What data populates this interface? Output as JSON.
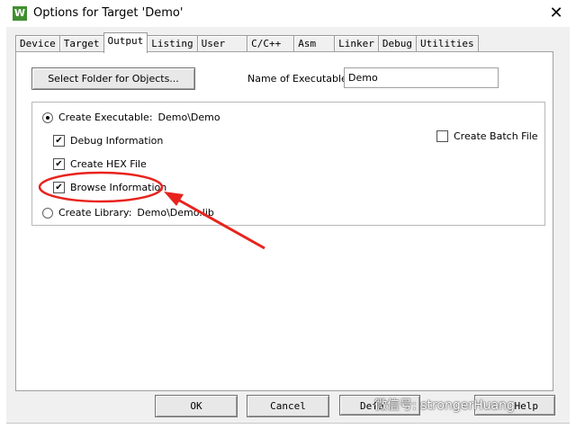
{
  "window": {
    "title": "Options for Target 'Demo'",
    "app_icon_glyph": "W",
    "close_glyph": "✕"
  },
  "tabs": [
    {
      "label": "Device"
    },
    {
      "label": "Target"
    },
    {
      "label": "Output",
      "active": true
    },
    {
      "label": "Listing"
    },
    {
      "label": "User"
    },
    {
      "label": "C/C++"
    },
    {
      "label": "Asm"
    },
    {
      "label": "Linker"
    },
    {
      "label": "Debug"
    },
    {
      "label": "Utilities"
    }
  ],
  "output": {
    "select_folder_label": "Select Folder for Objects...",
    "name_label": "Name of Executable:",
    "name_value": "Demo",
    "create_executable": {
      "label": "Create Executable:",
      "value": "Demo\\Demo",
      "selected": true
    },
    "debug_info": {
      "label": "Debug Information",
      "checked": true
    },
    "create_hex": {
      "label": "Create HEX File",
      "checked": true
    },
    "browse_info": {
      "label": "Browse Information",
      "checked": true
    },
    "create_library": {
      "label": "Create Library:",
      "value": "Demo\\Demo.lib",
      "selected": false
    },
    "create_batch": {
      "label": "Create Batch File",
      "checked": false
    }
  },
  "buttons": {
    "ok": "OK",
    "cancel": "Cancel",
    "defaults": "Defa",
    "help": "Help"
  },
  "watermark": "微信号: strongerHuang",
  "colors": {
    "annotation": "#e8231d",
    "checkmark": "✔"
  }
}
